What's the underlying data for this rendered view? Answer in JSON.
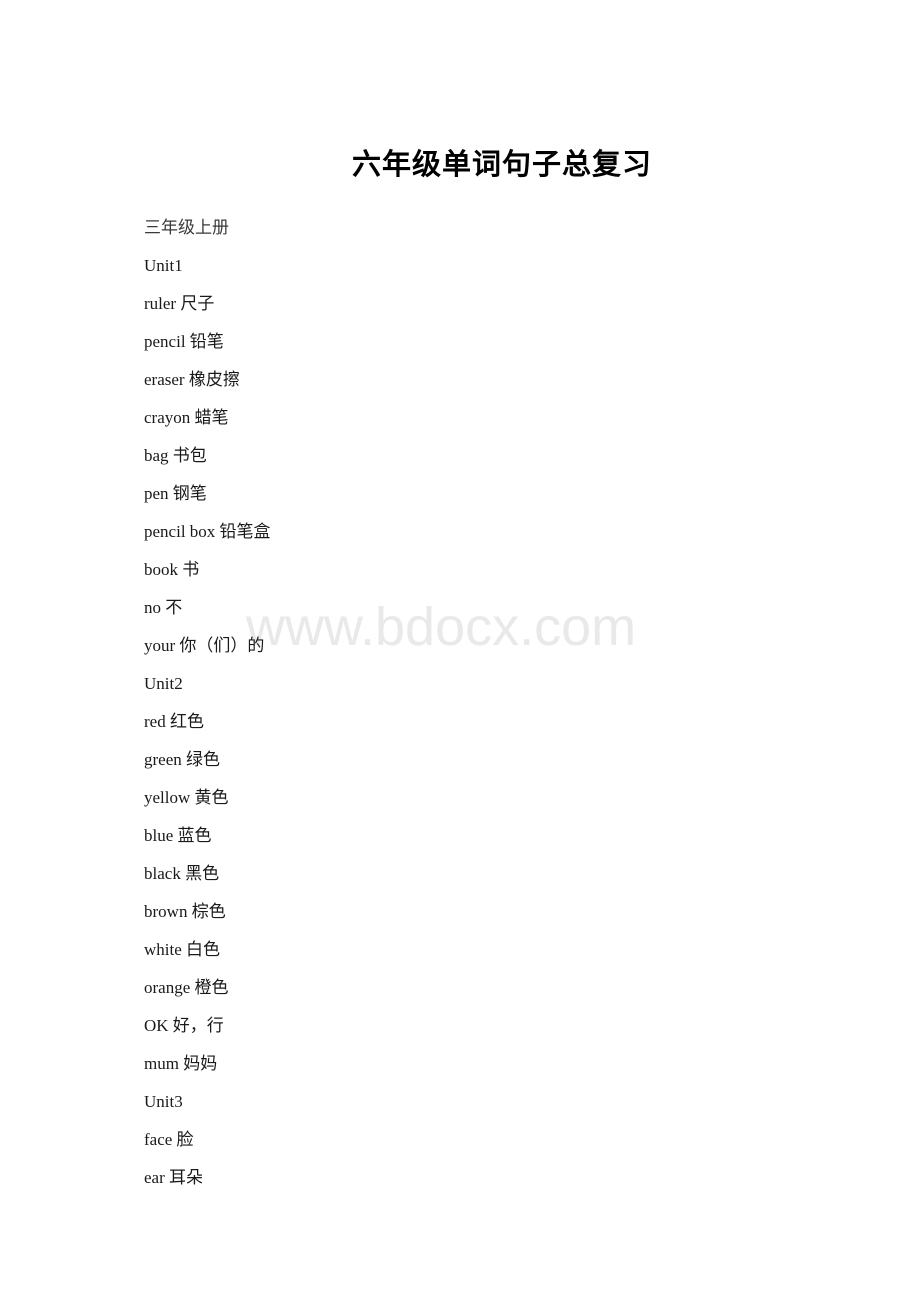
{
  "document": {
    "title": "六年级单词句子总复习",
    "watermark": "www.bdocx.com",
    "lines": [
      {
        "text": "三年级上册",
        "kind": "section"
      },
      {
        "text": "Unit1",
        "kind": "unit"
      },
      {
        "text": "ruler 尺子",
        "kind": "entry"
      },
      {
        "text": "pencil 铅笔",
        "kind": "entry"
      },
      {
        "text": "eraser 橡皮擦",
        "kind": "entry"
      },
      {
        "text": "crayon 蜡笔",
        "kind": "entry"
      },
      {
        "text": "bag 书包",
        "kind": "entry"
      },
      {
        "text": "pen 钢笔",
        "kind": "entry"
      },
      {
        "text": "pencil box 铅笔盒",
        "kind": "entry"
      },
      {
        "text": "book 书",
        "kind": "entry"
      },
      {
        "text": "no 不",
        "kind": "entry"
      },
      {
        "text": "your 你（们）的",
        "kind": "entry"
      },
      {
        "text": "Unit2",
        "kind": "unit"
      },
      {
        "text": "red 红色",
        "kind": "entry"
      },
      {
        "text": "green 绿色",
        "kind": "entry"
      },
      {
        "text": "yellow 黄色",
        "kind": "entry"
      },
      {
        "text": "blue 蓝色",
        "kind": "entry"
      },
      {
        "text": "black 黑色",
        "kind": "entry"
      },
      {
        "text": "brown 棕色",
        "kind": "entry"
      },
      {
        "text": "white 白色",
        "kind": "entry"
      },
      {
        "text": "orange 橙色",
        "kind": "entry"
      },
      {
        "text": "OK 好，行",
        "kind": "entry"
      },
      {
        "text": "mum 妈妈",
        "kind": "entry"
      },
      {
        "text": "Unit3",
        "kind": "unit"
      },
      {
        "text": "face 脸",
        "kind": "entry"
      },
      {
        "text": "ear 耳朵",
        "kind": "entry"
      }
    ]
  }
}
